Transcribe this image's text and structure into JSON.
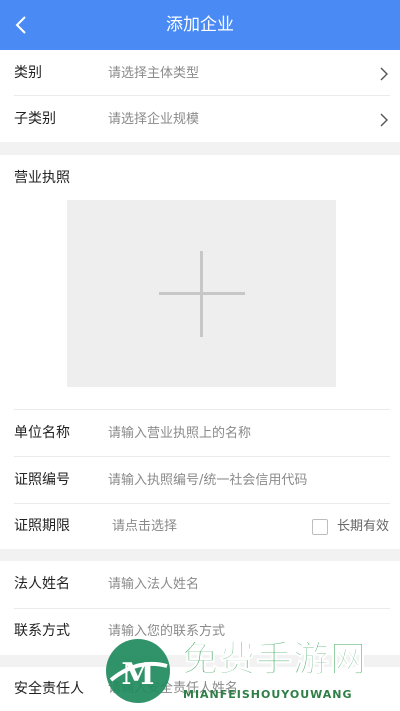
{
  "header": {
    "title": "添加企业"
  },
  "category": {
    "label": "类别",
    "placeholder": "请选择主体类型"
  },
  "subcategory": {
    "label": "子类别",
    "placeholder": "请选择企业规模"
  },
  "license": {
    "label": "营业执照"
  },
  "unit_name": {
    "label": "单位名称",
    "placeholder": "请输入营业执照上的名称"
  },
  "cert_no": {
    "label": "证照编号",
    "placeholder": "请输入执照编号/统一社会信用代码"
  },
  "cert_period": {
    "label": "证照期限",
    "placeholder": "请点击选择",
    "long_term_label": "长期有效"
  },
  "legal_name": {
    "label": "法人姓名",
    "placeholder": "请输入法人姓名"
  },
  "contact": {
    "label": "联系方式",
    "placeholder": "请输入您的联系方式"
  },
  "safety_officer": {
    "label": "安全责任人",
    "placeholder": "请输入安全责任人姓名"
  },
  "watermark": {
    "title": "免费手游网",
    "subtitle": "MIANFEISHOUYOUWANG",
    "logo_letter": "M"
  },
  "colors": {
    "header": "#4a8af4",
    "watermark": "#3aa55a"
  }
}
